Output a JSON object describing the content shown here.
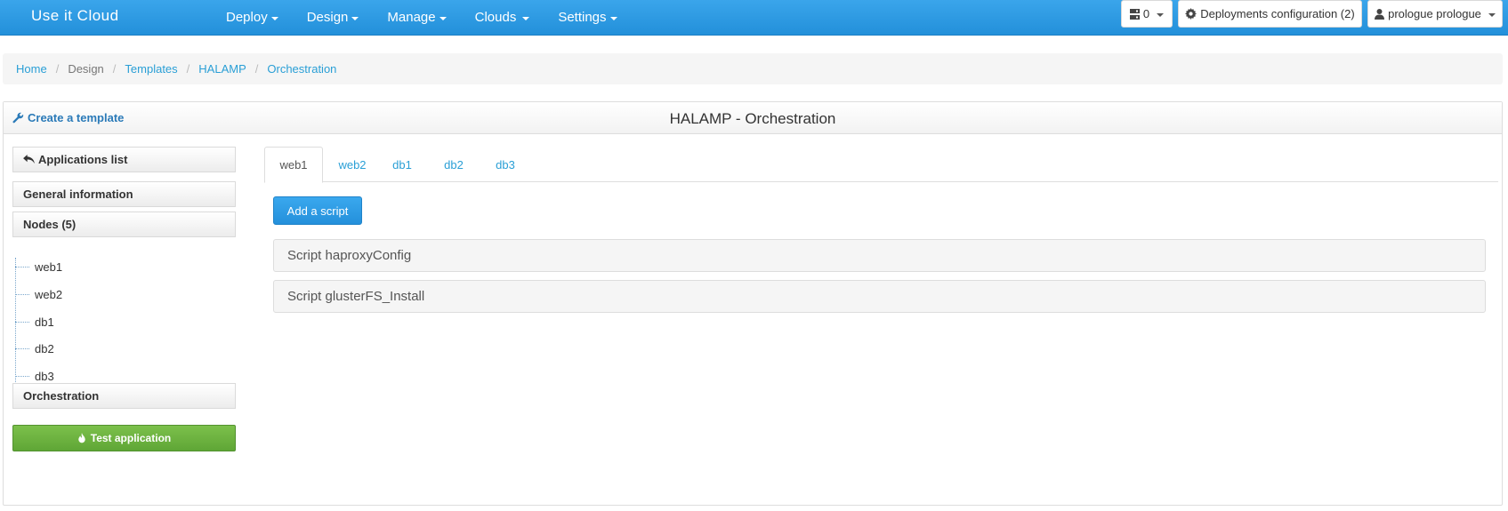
{
  "navbar": {
    "brand": "Use it Cloud",
    "menu": [
      {
        "label": "Deploy"
      },
      {
        "label": "Design"
      },
      {
        "label": "Manage"
      },
      {
        "label": "Clouds"
      },
      {
        "label": "Settings"
      }
    ],
    "servers_count": "0",
    "deployments_label": "Deployments configuration (2)",
    "user_label": "prologue prologue"
  },
  "breadcrumb": {
    "items": [
      "Home",
      "Design",
      "Templates",
      "HALAMP",
      "Orchestration"
    ]
  },
  "panel": {
    "create_label": "Create a template",
    "title": "HALAMP - Orchestration"
  },
  "sidebar": {
    "applications_list": "Applications list",
    "general_information": "General information",
    "nodes_label": "Nodes (5)",
    "nodes": [
      "web1",
      "web2",
      "db1",
      "db2",
      "db3"
    ],
    "orchestration": "Orchestration",
    "test_application": "Test application"
  },
  "main": {
    "tabs": [
      "web1",
      "web2",
      "db1",
      "db2",
      "db3"
    ],
    "active_tab": "web1",
    "add_script_label": "Add a script",
    "scripts": [
      "Script haproxyConfig",
      "Script glusterFS_Install"
    ]
  },
  "colors": {
    "navbar": "#2a9fd6",
    "link": "#2a9fd6",
    "success": "#62a83a"
  }
}
